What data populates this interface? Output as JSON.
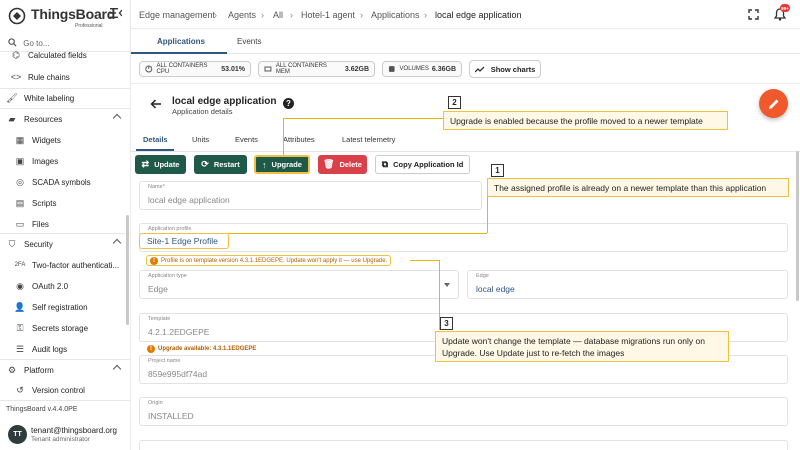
{
  "app": {
    "logo_name": "ThingsBoard",
    "logo_edition": "Professional",
    "goto_placeholder": "Go to...",
    "version": "ThingsBoard v.4.4.0PE"
  },
  "sidebar": {
    "items": [
      {
        "label": "Calculated fields",
        "icon": "calc-icon"
      },
      {
        "label": "Rule chains",
        "icon": "code-icon"
      },
      {
        "label": "White labeling",
        "icon": "paint-icon"
      },
      {
        "label": "Resources",
        "icon": "folder-icon",
        "expanded": true
      },
      {
        "label": "Widgets",
        "icon": "widgets-icon"
      },
      {
        "label": "Images",
        "icon": "image-icon"
      },
      {
        "label": "SCADA symbols",
        "icon": "scada-icon"
      },
      {
        "label": "Scripts",
        "icon": "script-icon"
      },
      {
        "label": "Files",
        "icon": "file-icon"
      },
      {
        "label": "Security",
        "icon": "shield-icon",
        "expanded": true
      },
      {
        "label": "Two-factor authenticati...",
        "icon": "twofa-icon"
      },
      {
        "label": "OAuth 2.0",
        "icon": "oauth-icon"
      },
      {
        "label": "Self registration",
        "icon": "person-add-icon"
      },
      {
        "label": "Secrets storage",
        "icon": "key-icon"
      },
      {
        "label": "Audit logs",
        "icon": "audit-icon"
      },
      {
        "label": "Platform",
        "icon": "gear-icon",
        "expanded": true
      },
      {
        "label": "Version control",
        "icon": "history-icon"
      }
    ]
  },
  "user": {
    "initials": "TT",
    "email": "tenant@thingsboard.org",
    "role": "Tenant administrator"
  },
  "breadcrumb": [
    "Edge management",
    "Agents",
    "All",
    "Hotel-1 agent",
    "Applications",
    "local edge application"
  ],
  "top_tabs": [
    "Applications",
    "Events"
  ],
  "stats": [
    {
      "label": "ALL CONTAINERS CPU",
      "value": "53.01%"
    },
    {
      "label": "ALL CONTAINERS MEM",
      "value": "3.62GB"
    },
    {
      "label": "VOLUMES",
      "value": "6.36GB"
    }
  ],
  "show_charts_label": "Show charts",
  "details": {
    "title": "local edge application",
    "subtitle": "Application details",
    "tabs": [
      "Details",
      "Units",
      "Events",
      "Attributes",
      "Latest telemetry"
    ],
    "buttons": {
      "update": "Update",
      "restart": "Restart",
      "upgrade": "Upgrade",
      "delete": "Delete",
      "copy_id": "Copy Application Id"
    },
    "fields": {
      "name_label": "Name*",
      "name_value": "local edge application",
      "profile_label": "Application profile",
      "profile_value": "Site-1 Edge Profile",
      "profile_warning": "Profile is on template version 4.3.1.1EDGEPE. Update won't apply it — use Upgrade.",
      "type_label": "Application type",
      "type_value": "Edge",
      "edge_label": "Edge",
      "edge_value": "local edge",
      "template_label": "Template",
      "template_value": "4.2.1.2EDGEPE",
      "template_warning": "Upgrade available: 4.3.1.1EDGEPE",
      "project_label": "Project name",
      "project_value": "859e995df74ad",
      "origin_label": "Origin",
      "origin_value": "INSTALLED"
    }
  },
  "callouts": [
    {
      "num": "1",
      "text": "The assigned profile is already on a newer template than this application"
    },
    {
      "num": "2",
      "text": "Upgrade is enabled because the profile moved to a newer template"
    },
    {
      "num": "3",
      "text_line1": "Update won't change the template — database migrations run only on",
      "text_line2": "Upgrade. Use Update just to re-fetch the images"
    }
  ],
  "colors": {
    "primary": "#305680",
    "green_button": "#1f5948",
    "red_button": "#d9404a",
    "fab": "#f0592c",
    "callout_border": "#f0c040",
    "warning": "#b25f00"
  }
}
